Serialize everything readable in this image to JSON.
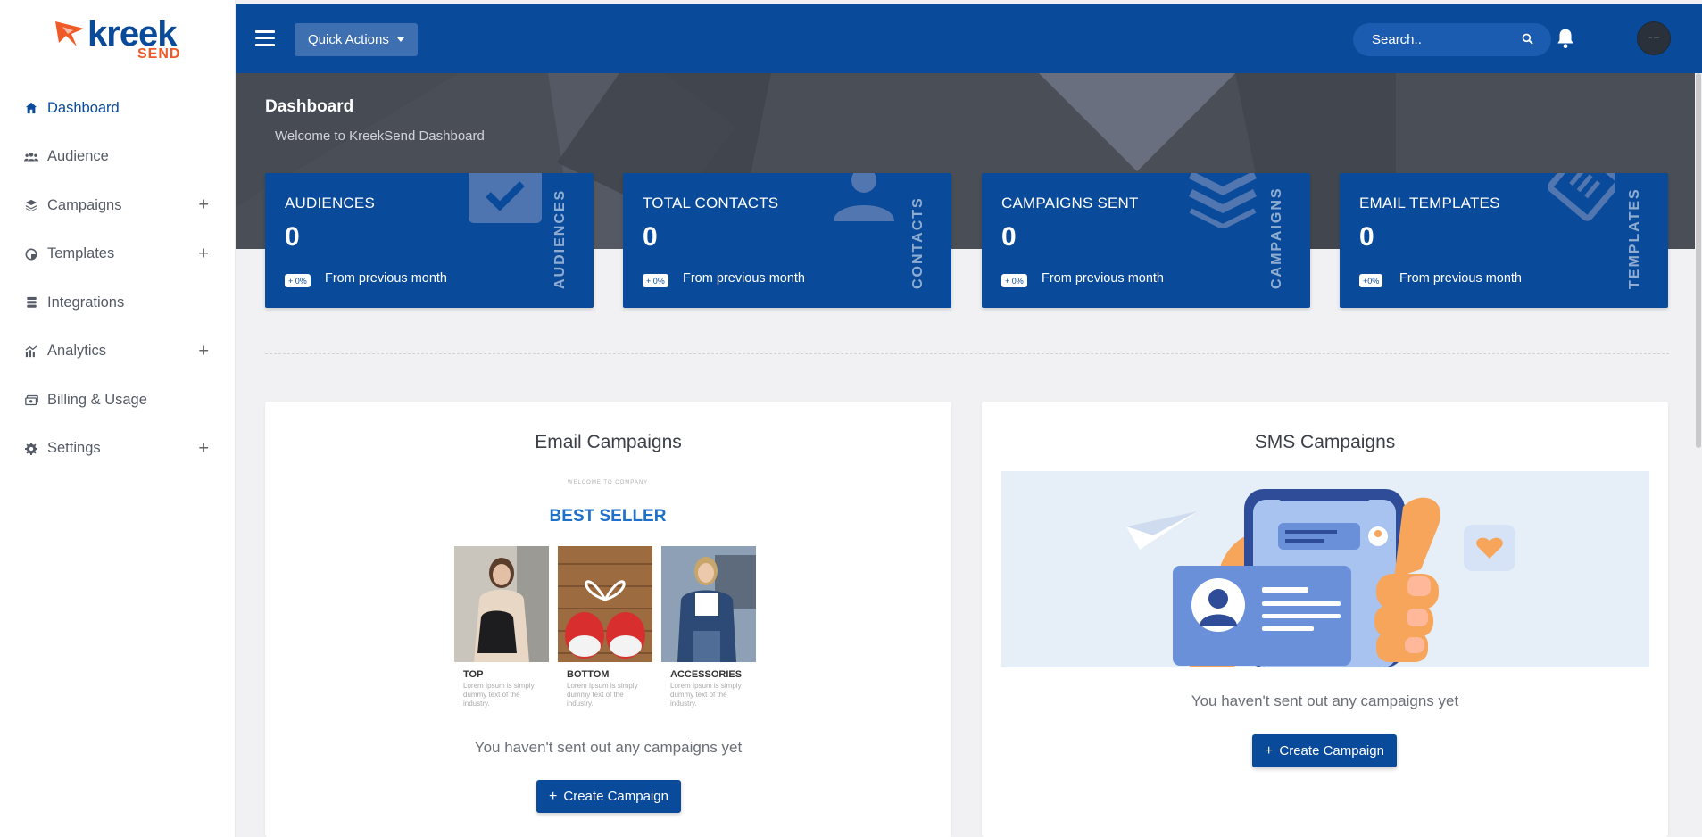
{
  "brand": {
    "name": "kreek",
    "sub": "SEND"
  },
  "sidebar": {
    "items": [
      {
        "label": "Dashboard",
        "icon": "home-icon",
        "active": true,
        "expandable": false
      },
      {
        "label": "Audience",
        "icon": "users-icon",
        "active": false,
        "expandable": false
      },
      {
        "label": "Campaigns",
        "icon": "layers-icon",
        "active": false,
        "expandable": true
      },
      {
        "label": "Templates",
        "icon": "palette-icon",
        "active": false,
        "expandable": true
      },
      {
        "label": "Integrations",
        "icon": "stack-icon",
        "active": false,
        "expandable": false
      },
      {
        "label": "Analytics",
        "icon": "chart-icon",
        "active": false,
        "expandable": true
      },
      {
        "label": "Billing & Usage",
        "icon": "money-icon",
        "active": false,
        "expandable": false
      },
      {
        "label": "Settings",
        "icon": "gear-icon",
        "active": false,
        "expandable": true
      }
    ],
    "expand_symbol": "+"
  },
  "header": {
    "quick_actions": "Quick Actions",
    "search_placeholder": "Search..",
    "avatar_text": "-- ---"
  },
  "page": {
    "title": "Dashboard",
    "subtitle": "Welcome to KreekSend Dashboard"
  },
  "stats": [
    {
      "title": "AUDIENCES",
      "value": "0",
      "change": "+ 0%",
      "foot": "From previous month",
      "vertical": "AUDIENCES"
    },
    {
      "title": "TOTAL CONTACTS",
      "value": "0",
      "change": "+ 0%",
      "foot": "From previous month",
      "vertical": "CONTACTS"
    },
    {
      "title": "CAMPAIGNS SENT",
      "value": "0",
      "change": "+ 0%",
      "foot": "From previous month",
      "vertical": "CAMPAIGNS"
    },
    {
      "title": "EMAIL TEMPLATES",
      "value": "0",
      "change": "+0%",
      "foot": "From previous month",
      "vertical": "TEMPLATES"
    }
  ],
  "email_panel": {
    "title": "Email Campaigns",
    "promo": {
      "welcome": "WELCOME TO COMPANY",
      "headline": "BEST SELLER",
      "items": [
        {
          "label": "TOP",
          "text": "Lorem Ipsum is simply dummy text of the industry."
        },
        {
          "label": "BOTTOM",
          "text": "Lorem Ipsum is simply dummy text of the industry."
        },
        {
          "label": "ACCESSORIES",
          "text": "Lorem Ipsum is simply dummy text of the industry."
        }
      ]
    },
    "empty": "You haven't sent out any campaigns yet",
    "button": "Create Campaign"
  },
  "sms_panel": {
    "title": "SMS Campaigns",
    "empty": "You haven't sent out any campaigns yet",
    "button": "Create Campaign"
  },
  "colors": {
    "primary": "#0a4a9a",
    "accent": "#f05a28",
    "hero": "#4a4e57"
  }
}
